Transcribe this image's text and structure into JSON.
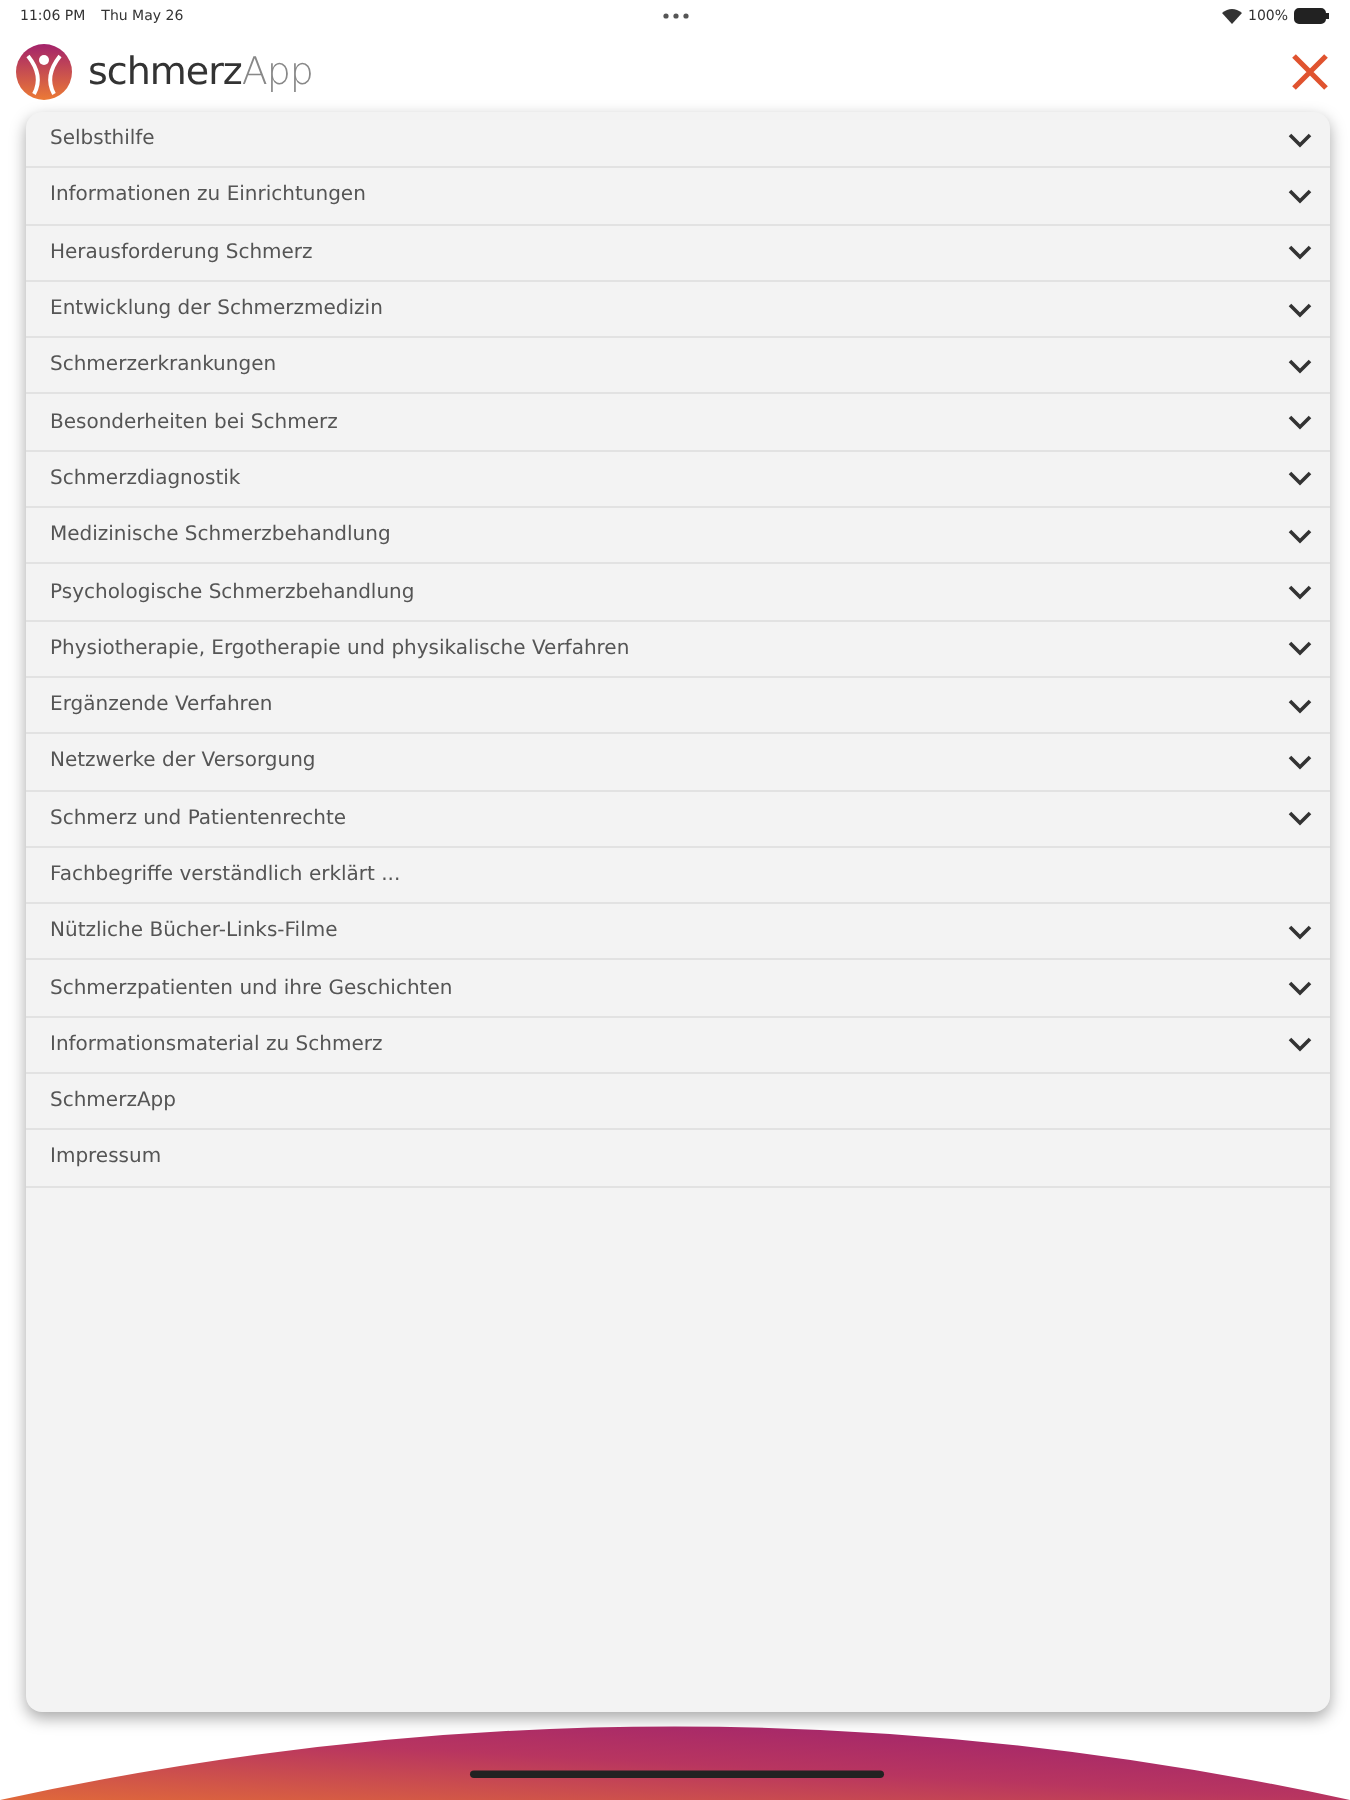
{
  "status_bar": {
    "time": "11:06 PM",
    "date": "Thu May 26",
    "battery": "100%"
  },
  "header": {
    "brand": "schmerz",
    "brand_suffix": "App"
  },
  "menu": [
    {
      "label": "Selbsthilfe",
      "expandable": true
    },
    {
      "label": "Informationen zu Einrichtungen",
      "expandable": true
    },
    {
      "label": "Herausforderung Schmerz",
      "expandable": true
    },
    {
      "label": "Entwicklung der Schmerzmedizin",
      "expandable": true
    },
    {
      "label": "Schmerzerkrankungen",
      "expandable": true
    },
    {
      "label": "Besonderheiten bei Schmerz",
      "expandable": true
    },
    {
      "label": "Schmerzdiagnostik",
      "expandable": true
    },
    {
      "label": "Medizinische Schmerzbehandlung",
      "expandable": true
    },
    {
      "label": "Psychologische Schmerzbehandlung",
      "expandable": true
    },
    {
      "label": "Physiotherapie, Ergotherapie und physikalische Verfahren",
      "expandable": true
    },
    {
      "label": "Ergänzende Verfahren",
      "expandable": true
    },
    {
      "label": "Netzwerke der Versorgung",
      "expandable": true
    },
    {
      "label": "Schmerz und Patientenrechte",
      "expandable": true
    },
    {
      "label": "Fachbegriffe verständlich erklärt ...",
      "expandable": false
    },
    {
      "label": "Nützliche Bücher-Links-Filme",
      "expandable": true
    },
    {
      "label": "Schmerzpatienten und ihre Geschichten",
      "expandable": true
    },
    {
      "label": "Informationsmaterial zu Schmerz",
      "expandable": true
    },
    {
      "label": "SchmerzApp",
      "expandable": false
    },
    {
      "label": "Impressum",
      "expandable": false
    }
  ]
}
